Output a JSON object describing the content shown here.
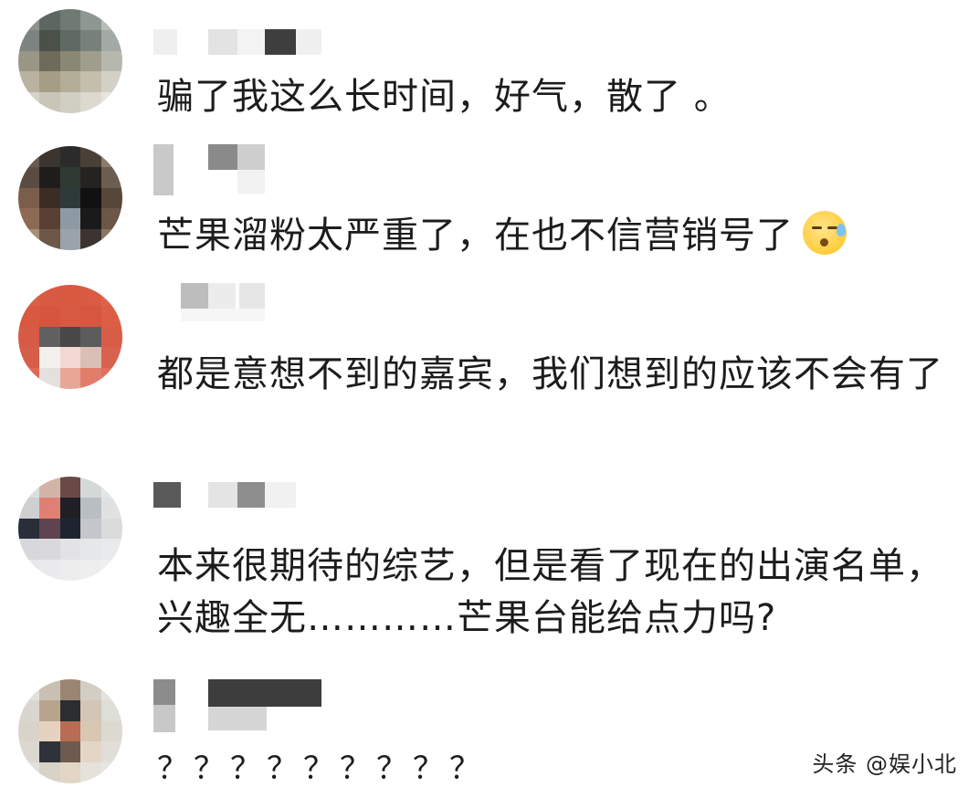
{
  "comments": [
    {
      "text": "骗了我这么长时间，好气，散了 。"
    },
    {
      "text": "芒果溜粉太严重了，在也不信营销号了",
      "emoji": "sleepy-sweat-emoji"
    },
    {
      "text": "都是意想不到的嘉宾，我们想到的应该不会有了"
    },
    {
      "text": "本来很期待的综艺，但是看了现在的出演名单，兴趣全无…………芒果台能给点力吗?"
    },
    {
      "text": "？？？？？？？？？"
    }
  ],
  "watermark": "头条 @娱小北",
  "colors": {
    "text": "#1c1c1c",
    "background": "#ffffff"
  }
}
